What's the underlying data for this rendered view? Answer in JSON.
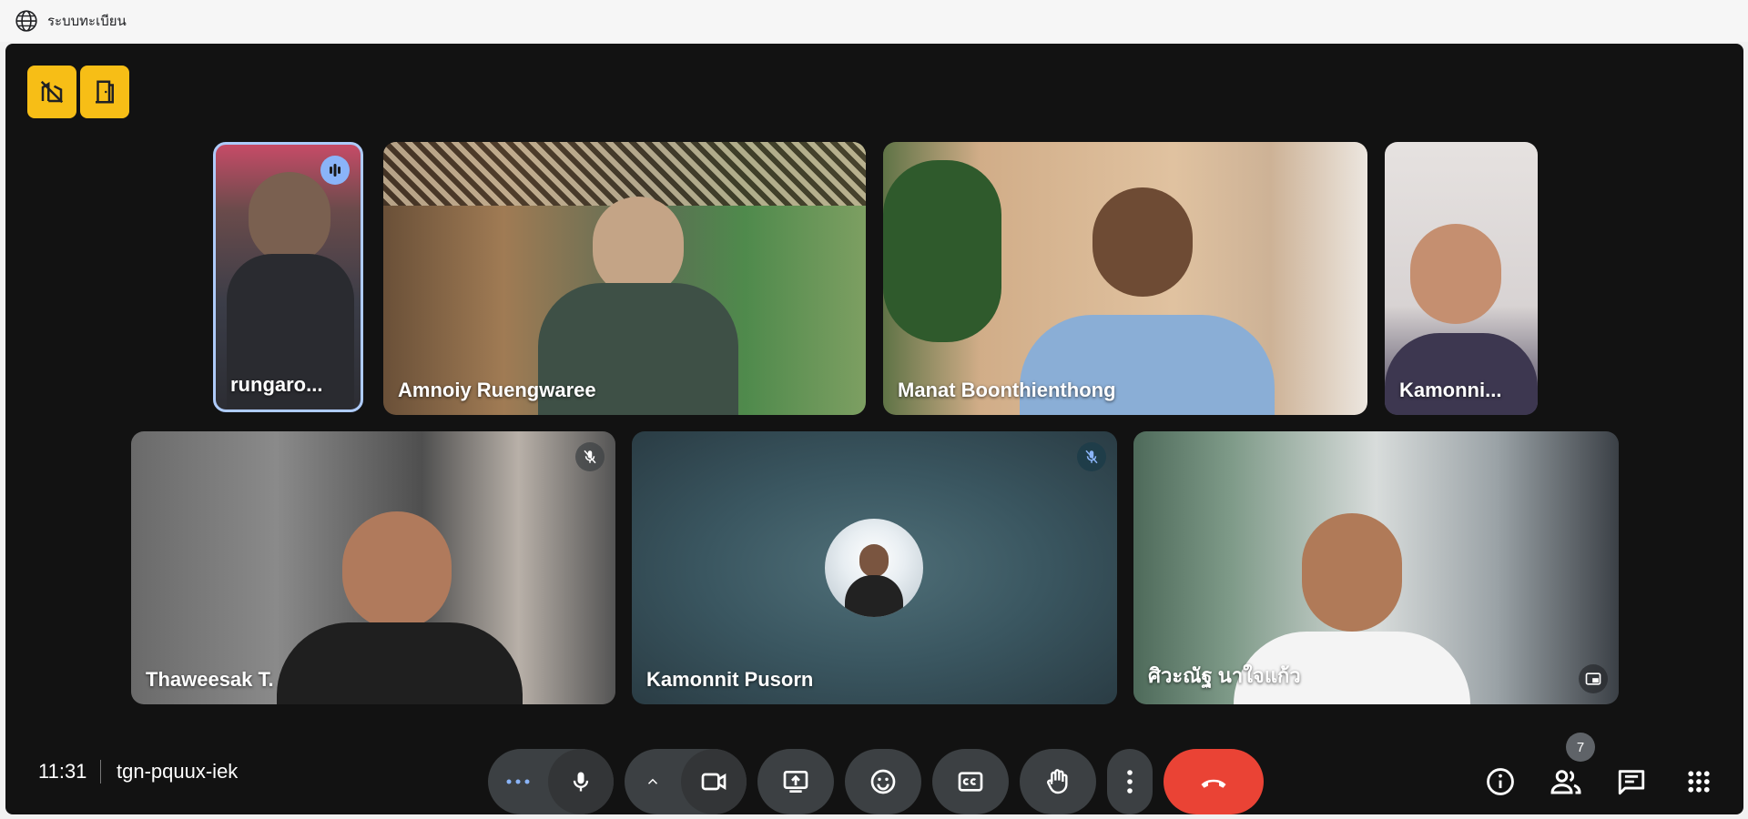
{
  "browser": {
    "tab_title": "ระบบทะเบียน"
  },
  "participants": [
    {
      "name": "rungaro...",
      "speaking": true
    },
    {
      "name": "Amnoiy Ruengwaree"
    },
    {
      "name": "Manat Boonthienthong"
    },
    {
      "name": "Kamonni..."
    },
    {
      "name": "Thaweesak T.",
      "muted": true
    },
    {
      "name": "Kamonnit Pusorn",
      "muted": true
    },
    {
      "name": "ศิวะณัฐ นาใจแก้ว"
    }
  ],
  "meeting": {
    "time": "11:31",
    "code": "tgn-pquux-iek"
  },
  "people_count": "7",
  "colors": {
    "accent": "#f7be16",
    "end_call": "#ea4335",
    "speaking_ring": "#aecbfa"
  }
}
